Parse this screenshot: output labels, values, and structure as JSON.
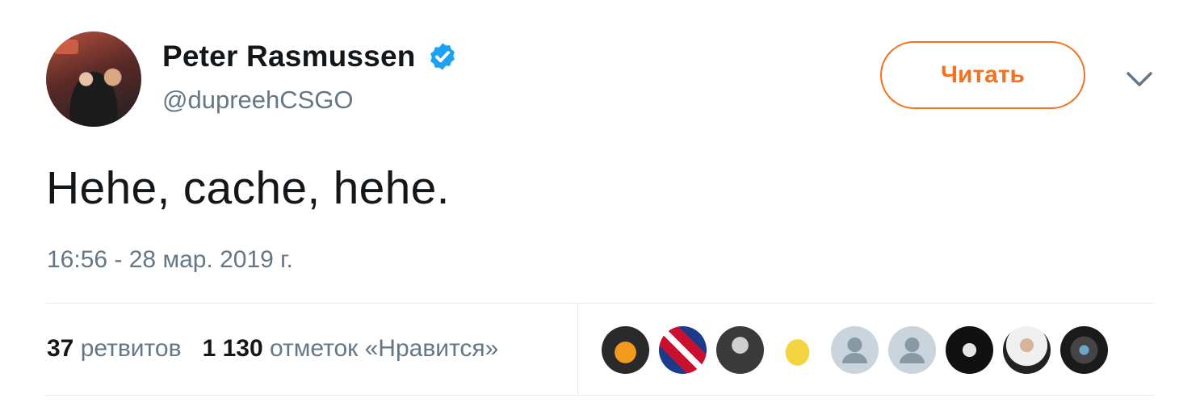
{
  "author": {
    "name": "Peter Rasmussen",
    "handle": "@dupreehCSGO",
    "verified": true,
    "avatar_icon": "user-avatar-photo"
  },
  "follow_button": {
    "label": "Читать"
  },
  "menu_icon": "chevron-down-icon",
  "tweet": {
    "text": "Hehe, cache, hehe.",
    "timestamp": "16:56 - 28 мар. 2019 г."
  },
  "stats": {
    "retweets_count": "37",
    "retweets_label": "ретвитов",
    "likes_count": "1 130",
    "likes_label": "отметок «Нравится»"
  },
  "likers": [
    {
      "icon": "overwatch-league-avatar"
    },
    {
      "icon": "flag-logo-avatar"
    },
    {
      "icon": "person-photo-avatar"
    },
    {
      "icon": "pikachu-avatar"
    },
    {
      "icon": "default-profile-avatar"
    },
    {
      "icon": "default-profile-avatar"
    },
    {
      "icon": "dark-art-avatar"
    },
    {
      "icon": "person-photo-avatar"
    },
    {
      "icon": "mask-art-avatar"
    }
  ],
  "colors": {
    "accent": "#f4721f",
    "verified": "#1da1f2",
    "secondary_text": "#657786",
    "primary_text": "#14171a"
  }
}
